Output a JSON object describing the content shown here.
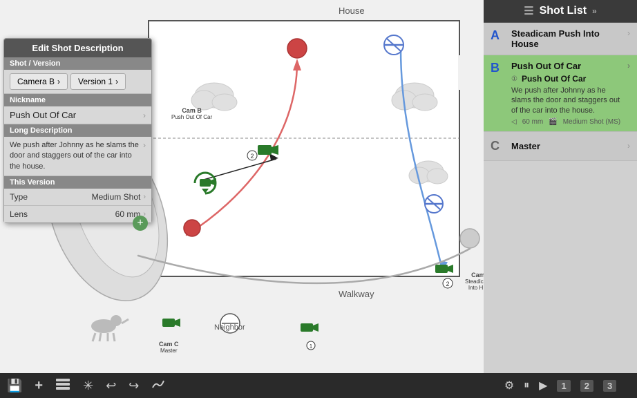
{
  "sidebar": {
    "title": "Shot List",
    "shots": [
      {
        "label": "A",
        "labelColor": "blue",
        "title": "Steadicam Push Into House",
        "active": false,
        "showDetail": false
      },
      {
        "label": "B",
        "labelColor": "blue",
        "title": "Push Out Of Car",
        "active": true,
        "description": "We push after Johnny as he slams the door and staggers out of the car into the house.",
        "meta_lens": "60 mm",
        "meta_type": "Medium Shot (MS)"
      },
      {
        "label": "C",
        "labelColor": "gray",
        "title": "Master",
        "active": false,
        "showDetail": false
      }
    ]
  },
  "edit_panel": {
    "title": "Edit Shot Description",
    "shot_version_label": "Shot / Version",
    "camera_label": "Camera B",
    "version_label": "Version 1",
    "nickname_label": "Nickname",
    "nickname_value": "Push Out Of Car",
    "long_desc_label": "Long Description",
    "long_desc_value": "We push after Johnny as he slams the door and staggers out of the car into the house.",
    "this_version_label": "This Version",
    "type_label": "Type",
    "type_value": "Medium Shot",
    "lens_label": "Lens",
    "lens_value": "60 mm"
  },
  "canvas": {
    "house_label": "House",
    "walkway_label": "Walkway",
    "neighbor_label": "Neighbor",
    "cam_b_label": "Cam B",
    "cam_b_sub": "Push Out Of Car",
    "cam_c_label": "Cam C",
    "cam_c_sub": "Master",
    "cam_steadicam_label": "Cam",
    "cam_steadicam_sub": "Steadicam Into H..."
  },
  "toolbar": {
    "save_icon": "💾",
    "add_icon": "+",
    "layers_icon": "⊞",
    "star_icon": "✳",
    "undo_icon": "↩",
    "redo_icon": "↪",
    "edit_icon": "✎",
    "gear_icon": "⚙",
    "pause_icon": "⏸",
    "play_icon": "▶",
    "page1": "1",
    "page2": "2",
    "page3": "3"
  }
}
